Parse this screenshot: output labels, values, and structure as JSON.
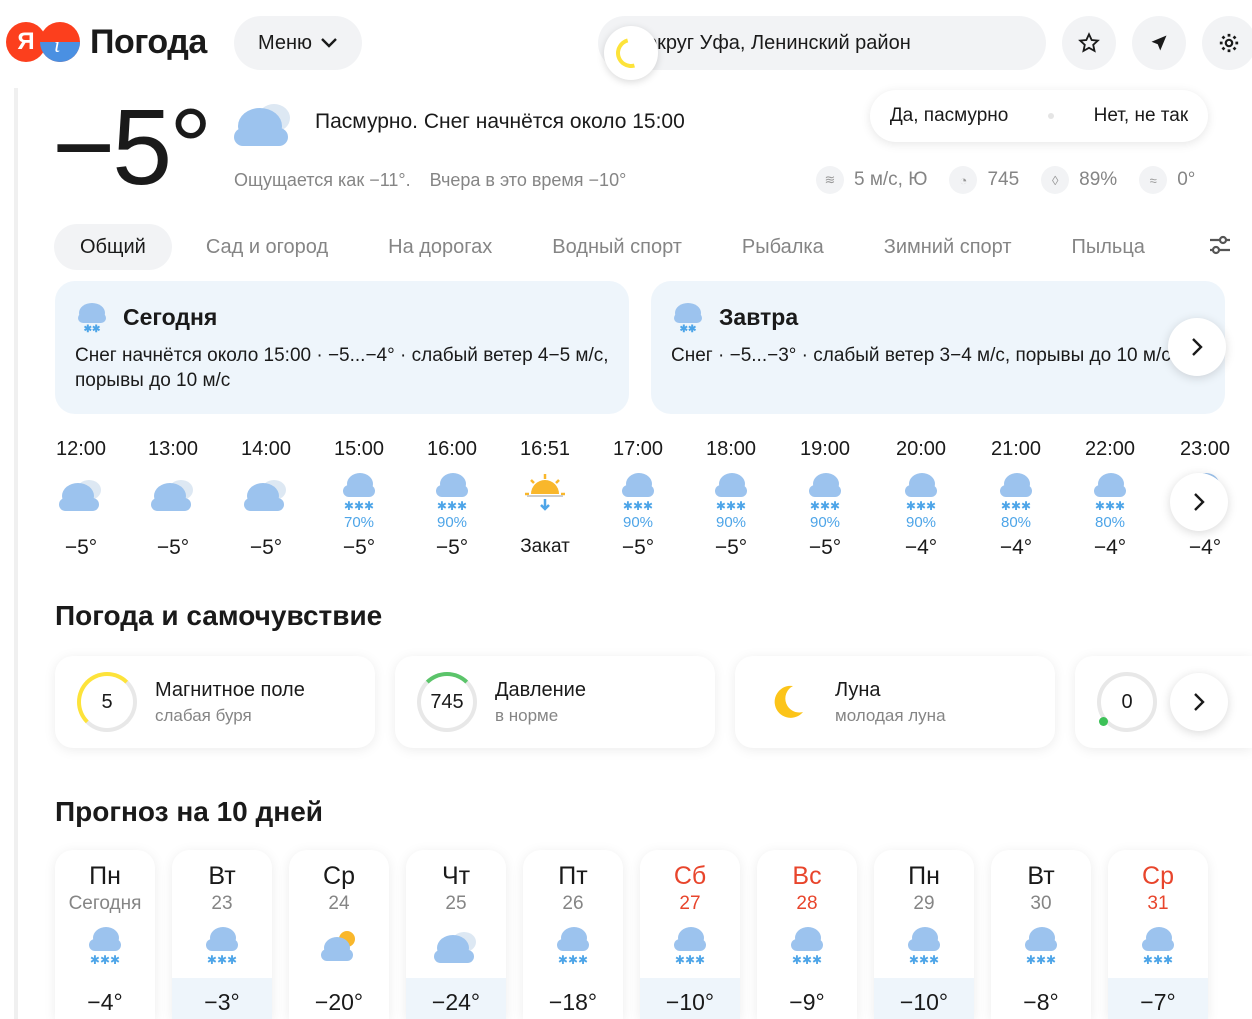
{
  "header": {
    "logo_ya": "Я",
    "brand": "Погода",
    "menu_label": "Меню",
    "location": "округ Уфа, Ленинский район",
    "icons": [
      "star-icon",
      "location-arrow-icon",
      "gear-icon"
    ]
  },
  "current": {
    "temperature": "−5°",
    "condition": "Пасмурно. Снег начнётся около 15:00",
    "feels_like": "Ощущается как −11°.",
    "yesterday": "Вчера в это время −10°",
    "feedback_yes": "Да, пасмурно",
    "feedback_no": "Нет, не так",
    "wind": "5 м/с, Ю",
    "pressure": "745",
    "humidity": "89%",
    "water": "0°"
  },
  "tabs": [
    "Общий",
    "Сад и огород",
    "На дорогах",
    "Водный спорт",
    "Рыбалка",
    "Зимний спорт",
    "Пыльца"
  ],
  "today": {
    "title": "Сегодня",
    "text": "Снег начнётся около 15:00 · −5...−4° · слабый ветер 4−5 м/с, порывы до 10 м/с"
  },
  "tomorrow": {
    "title": "Завтра",
    "text": "Снег · −5...−3° · слабый ветер 3−4 м/с, порывы до 10 м/с"
  },
  "hourly": [
    {
      "time": "12:00",
      "icon": "cloud-icon",
      "prob": "",
      "temp": "−5°"
    },
    {
      "time": "13:00",
      "icon": "cloud-icon",
      "prob": "",
      "temp": "−5°"
    },
    {
      "time": "14:00",
      "icon": "cloud-icon",
      "prob": "",
      "temp": "−5°"
    },
    {
      "time": "15:00",
      "icon": "snow-icon",
      "prob": "70%",
      "temp": "−5°"
    },
    {
      "time": "16:00",
      "icon": "snow-icon",
      "prob": "90%",
      "temp": "−5°"
    },
    {
      "time": "16:51",
      "icon": "sunset-icon",
      "prob": "",
      "temp": "Закат"
    },
    {
      "time": "17:00",
      "icon": "snow-icon",
      "prob": "90%",
      "temp": "−5°"
    },
    {
      "time": "18:00",
      "icon": "snow-icon",
      "prob": "90%",
      "temp": "−5°"
    },
    {
      "time": "19:00",
      "icon": "snow-icon",
      "prob": "90%",
      "temp": "−5°"
    },
    {
      "time": "20:00",
      "icon": "snow-icon",
      "prob": "90%",
      "temp": "−4°"
    },
    {
      "time": "21:00",
      "icon": "snow-icon",
      "prob": "80%",
      "temp": "−4°"
    },
    {
      "time": "22:00",
      "icon": "snow-icon",
      "prob": "80%",
      "temp": "−4°"
    },
    {
      "time": "23:00",
      "icon": "snow-icon",
      "prob": "",
      "temp": "−4°"
    }
  ],
  "wellbeing": {
    "title": "Погода и самочувствие",
    "cards": [
      {
        "value": "5",
        "title": "Магнитное поле",
        "sub": "слабая буря"
      },
      {
        "value": "745",
        "title": "Давление",
        "sub": "в норме"
      },
      {
        "value": "",
        "title": "Луна",
        "sub": "молодая луна"
      },
      {
        "value": "0",
        "title": "",
        "sub": ""
      }
    ]
  },
  "forecast": {
    "title": "Прогноз на 10 дней",
    "days": [
      {
        "day": "Пн",
        "date": "Сегодня",
        "weekend": false,
        "icon": "snow-icon",
        "temp": "−4°"
      },
      {
        "day": "Вт",
        "date": "23",
        "weekend": false,
        "icon": "snow-icon",
        "temp": "−3°"
      },
      {
        "day": "Ср",
        "date": "24",
        "weekend": false,
        "icon": "partly-cloudy-icon",
        "temp": "−20°"
      },
      {
        "day": "Чт",
        "date": "25",
        "weekend": false,
        "icon": "cloud-icon",
        "temp": "−24°"
      },
      {
        "day": "Пт",
        "date": "26",
        "weekend": false,
        "icon": "snow-icon",
        "temp": "−18°"
      },
      {
        "day": "Сб",
        "date": "27",
        "weekend": true,
        "icon": "snow-icon",
        "temp": "−10°"
      },
      {
        "day": "Вс",
        "date": "28",
        "weekend": true,
        "icon": "snow-icon",
        "temp": "−9°"
      },
      {
        "day": "Пн",
        "date": "29",
        "weekend": false,
        "icon": "snow-icon",
        "temp": "−10°"
      },
      {
        "day": "Вт",
        "date": "30",
        "weekend": false,
        "icon": "snow-icon",
        "temp": "−8°"
      },
      {
        "day": "Ср",
        "date": "31",
        "weekend": true,
        "icon": "snow-icon",
        "temp": "−7°"
      }
    ]
  },
  "colors": {
    "accent": "#fc3f1d",
    "snow": "#4ea5e8",
    "card_bg": "#eef5fb",
    "weekend": "#e8452c"
  }
}
